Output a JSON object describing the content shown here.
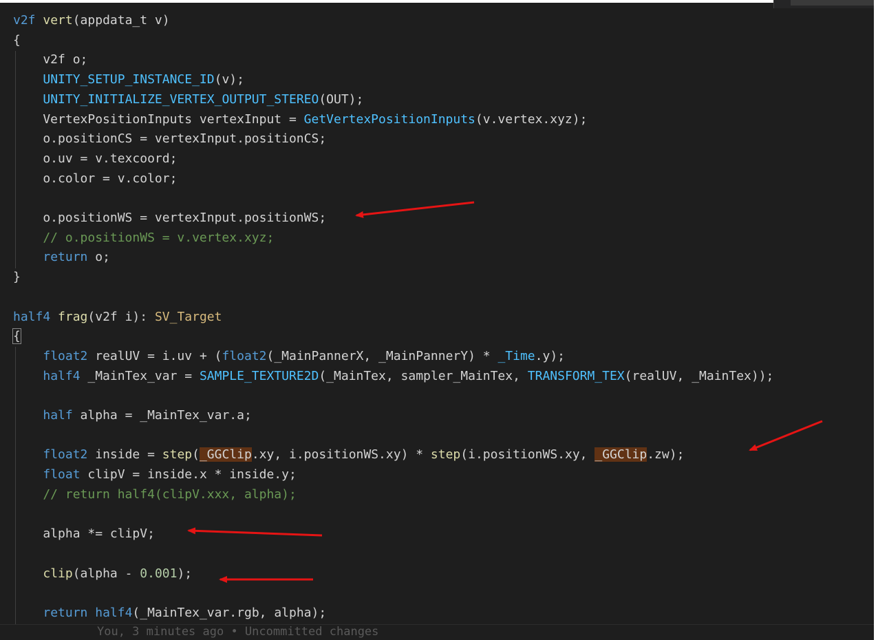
{
  "editor": {
    "lines": [
      {
        "name": "line-vert-signature",
        "tokens": [
          {
            "t": "v2f ",
            "c": "kw"
          },
          {
            "t": "vert",
            "c": "fn"
          },
          {
            "t": "(appdata_t v)",
            "c": ""
          }
        ]
      },
      {
        "name": "line-brace-open-vert",
        "tokens": [
          {
            "t": "{",
            "c": ""
          }
        ]
      },
      {
        "name": "line-v2f-o",
        "tokens": [
          {
            "t": "    v2f o;",
            "c": ""
          }
        ]
      },
      {
        "name": "line-setup-instance",
        "tokens": [
          {
            "t": "    ",
            "c": ""
          },
          {
            "t": "UNITY_SETUP_INSTANCE_ID",
            "c": "mac"
          },
          {
            "t": "(v);",
            "c": ""
          }
        ]
      },
      {
        "name": "line-init-stereo",
        "tokens": [
          {
            "t": "    ",
            "c": ""
          },
          {
            "t": "UNITY_INITIALIZE_VERTEX_OUTPUT_STEREO",
            "c": "mac"
          },
          {
            "t": "(OUT);",
            "c": ""
          }
        ]
      },
      {
        "name": "line-vertex-input",
        "tokens": [
          {
            "t": "    VertexPositionInputs vertexInput = ",
            "c": ""
          },
          {
            "t": "GetVertexPositionInputs",
            "c": "mac"
          },
          {
            "t": "(v.vertex.xyz);",
            "c": ""
          }
        ]
      },
      {
        "name": "line-position-cs",
        "tokens": [
          {
            "t": "    o.positionCS = vertexInput.positionCS;",
            "c": ""
          }
        ]
      },
      {
        "name": "line-uv",
        "tokens": [
          {
            "t": "    o.uv = v.texcoord;",
            "c": ""
          }
        ]
      },
      {
        "name": "line-color",
        "tokens": [
          {
            "t": "    o.color = v.color;",
            "c": ""
          }
        ]
      },
      {
        "name": "line-blank-1",
        "tokens": [
          {
            "t": "",
            "c": ""
          }
        ]
      },
      {
        "name": "line-position-ws",
        "tokens": [
          {
            "t": "    o.positionWS = vertexInput.positionWS;",
            "c": ""
          }
        ]
      },
      {
        "name": "line-comment-ws",
        "tokens": [
          {
            "t": "    // o.positionWS = v.vertex.xyz;",
            "c": "cm"
          }
        ]
      },
      {
        "name": "line-return-o",
        "tokens": [
          {
            "t": "    ",
            "c": ""
          },
          {
            "t": "return",
            "c": "kw"
          },
          {
            "t": " o;",
            "c": ""
          }
        ]
      },
      {
        "name": "line-brace-close-vert",
        "tokens": [
          {
            "t": "}",
            "c": ""
          }
        ]
      },
      {
        "name": "line-blank-2",
        "tokens": [
          {
            "t": "",
            "c": ""
          }
        ]
      },
      {
        "name": "line-frag-signature",
        "tokens": [
          {
            "t": "half4 ",
            "c": "kw"
          },
          {
            "t": "frag",
            "c": "fn"
          },
          {
            "t": "(v2f i): ",
            "c": ""
          },
          {
            "t": "SV_Target",
            "c": "sem"
          }
        ]
      },
      {
        "name": "line-brace-open-frag",
        "tokens": [
          {
            "t": "{",
            "c": "box"
          }
        ]
      },
      {
        "name": "line-real-uv",
        "tokens": [
          {
            "t": "    ",
            "c": ""
          },
          {
            "t": "float2",
            "c": "kw"
          },
          {
            "t": " realUV = i.uv + (",
            "c": ""
          },
          {
            "t": "float2",
            "c": "kw"
          },
          {
            "t": "(_MainPannerX, _MainPannerY) * ",
            "c": ""
          },
          {
            "t": "_Time",
            "c": "mac"
          },
          {
            "t": ".y);",
            "c": ""
          }
        ]
      },
      {
        "name": "line-maintex-var",
        "tokens": [
          {
            "t": "    ",
            "c": ""
          },
          {
            "t": "half4",
            "c": "kw"
          },
          {
            "t": " _MainTex_var = ",
            "c": ""
          },
          {
            "t": "SAMPLE_TEXTURE2D",
            "c": "mac"
          },
          {
            "t": "(_MainTex, sampler_MainTex, ",
            "c": ""
          },
          {
            "t": "TRANSFORM_TEX",
            "c": "mac"
          },
          {
            "t": "(realUV, _MainTex));",
            "c": ""
          }
        ]
      },
      {
        "name": "line-blank-3",
        "tokens": [
          {
            "t": "",
            "c": ""
          }
        ]
      },
      {
        "name": "line-half-alpha",
        "tokens": [
          {
            "t": "    ",
            "c": ""
          },
          {
            "t": "half",
            "c": "kw"
          },
          {
            "t": " alpha = _MainTex_var.a;",
            "c": ""
          }
        ]
      },
      {
        "name": "line-blank-4",
        "tokens": [
          {
            "t": "",
            "c": ""
          }
        ]
      },
      {
        "name": "line-inside",
        "tokens": [
          {
            "t": "    ",
            "c": ""
          },
          {
            "t": "float2",
            "c": "kw"
          },
          {
            "t": " inside = ",
            "c": ""
          },
          {
            "t": "step",
            "c": "fn"
          },
          {
            "t": "(",
            "c": ""
          },
          {
            "t": "_GGClip",
            "c": "hl"
          },
          {
            "t": ".xy, i.positionWS.xy) * ",
            "c": ""
          },
          {
            "t": "step",
            "c": "fn"
          },
          {
            "t": "(i.positionWS.xy, ",
            "c": ""
          },
          {
            "t": "_GGClip",
            "c": "hl"
          },
          {
            "t": ".zw);",
            "c": ""
          }
        ]
      },
      {
        "name": "line-clipv",
        "tokens": [
          {
            "t": "    ",
            "c": ""
          },
          {
            "t": "float",
            "c": "kw"
          },
          {
            "t": " clipV = inside.x * inside.y;",
            "c": ""
          }
        ]
      },
      {
        "name": "line-comment-return",
        "tokens": [
          {
            "t": "    // return half4(clipV.xxx, alpha);",
            "c": "cm"
          }
        ]
      },
      {
        "name": "line-blank-5",
        "tokens": [
          {
            "t": "",
            "c": ""
          }
        ]
      },
      {
        "name": "line-alpha-mul",
        "tokens": [
          {
            "t": "    alpha *= clipV;",
            "c": ""
          }
        ]
      },
      {
        "name": "line-blank-6",
        "tokens": [
          {
            "t": "",
            "c": ""
          }
        ]
      },
      {
        "name": "line-clip-call",
        "tokens": [
          {
            "t": "    ",
            "c": ""
          },
          {
            "t": "clip",
            "c": "fn"
          },
          {
            "t": "(alpha - ",
            "c": ""
          },
          {
            "t": "0.001",
            "c": "num"
          },
          {
            "t": ");",
            "c": ""
          }
        ]
      },
      {
        "name": "line-blank-7",
        "tokens": [
          {
            "t": "",
            "c": ""
          }
        ]
      },
      {
        "name": "line-return-half4",
        "tokens": [
          {
            "t": "    ",
            "c": ""
          },
          {
            "t": "return",
            "c": "kw"
          },
          {
            "t": " ",
            "c": ""
          },
          {
            "t": "half4",
            "c": "kw"
          },
          {
            "t": "(_MainTex_var.rgb, alpha);",
            "c": ""
          }
        ]
      }
    ],
    "blame_text": "You, 3 minutes ago • Uncommitted changes"
  },
  "colors": {
    "background": "#1e1e1e",
    "keyword": "#569cd6",
    "function": "#dcdcaa",
    "macro": "#4fc1ff",
    "number": "#b5cea8",
    "comment": "#6a9955",
    "semantic": "#d7ba7d",
    "highlight": "#613214",
    "annotation_arrow": "#e51414"
  }
}
